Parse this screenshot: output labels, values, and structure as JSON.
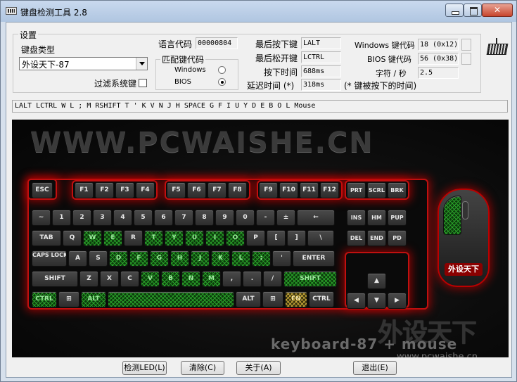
{
  "window": {
    "title": "键盘检测工具 2.8"
  },
  "settings": {
    "group_title": "设置",
    "keyboard_type_label": "键盘类型",
    "keyboard_type_value": "外设天下-87",
    "filter_label": "过滤系统键",
    "lang_code_label": "语言代码",
    "lang_code_value": "00000804",
    "match_code_label": "匹配键代码",
    "windows_label": "Windows",
    "bios_label": "BIOS",
    "selected_match": "BIOS",
    "last_press_label": "最后按下键",
    "last_press_value": "LALT",
    "last_release_label": "最后松开键",
    "last_release_value": "LCTRL",
    "press_time_label": "按下时间",
    "press_time_value": "688ms",
    "delay_label": "延迟时间 (*)",
    "delay_value": "318ms",
    "delay_note": "(* 键被按下的时间)",
    "win_code_label": "Windows 键代码",
    "win_code_value": "18 (0x12)",
    "bios_code_label": "BIOS 键代码",
    "bios_code_value": "56 (0x38)",
    "cps_label": "字符 / 秒",
    "cps_value": "2.5"
  },
  "log": "LALT LCTRL W L ; M RSHIFT T ' K V N J H SPACE G F I U Y D E B O L Mouse",
  "banner": {
    "site": "WWW.PCWAISHE.CN",
    "product": "keyboard-87 + mouse",
    "url": "www.pcwaishe.cn",
    "cn_logo": "外设天下",
    "mouse_logo": "外设天下"
  },
  "keyboard": {
    "rows": [
      [
        {
          "k": "ESC"
        }
      ],
      [
        {
          "k": "F1"
        },
        {
          "k": "F2"
        },
        {
          "k": "F3"
        },
        {
          "k": "F4"
        }
      ],
      [
        {
          "k": "F5"
        },
        {
          "k": "F6"
        },
        {
          "k": "F7"
        },
        {
          "k": "F8"
        }
      ],
      [
        {
          "k": "F9"
        },
        {
          "k": "F10"
        },
        {
          "k": "F11"
        },
        {
          "k": "F12"
        }
      ],
      [
        {
          "k": "PRT"
        },
        {
          "k": "SCRL"
        },
        {
          "k": "BRK"
        }
      ]
    ],
    "esc": "ESC",
    "fn_labels": [
      "F1",
      "F2",
      "F3",
      "F4",
      "F5",
      "F6",
      "F7",
      "F8",
      "F9",
      "F10",
      "F11",
      "F12"
    ],
    "sys_labels": [
      "PRT",
      "SCRL",
      "BRK"
    ],
    "num_row": [
      "~",
      "1",
      "2",
      "3",
      "4",
      "5",
      "6",
      "7",
      "8",
      "9",
      "0",
      "-",
      "±",
      "←"
    ],
    "q_row": [
      "TAB",
      "Q",
      "W",
      "E",
      "R",
      "T",
      "Y",
      "U",
      "I",
      "O",
      "P",
      "[",
      "]",
      "\\"
    ],
    "q_row_on": [
      false,
      false,
      true,
      true,
      false,
      true,
      true,
      true,
      true,
      true,
      false,
      false,
      false,
      false
    ],
    "a_row": [
      "CAPS LOCK",
      "A",
      "S",
      "D",
      "F",
      "G",
      "H",
      "J",
      "K",
      "L",
      ";",
      "'",
      "ENTER"
    ],
    "a_row_on": [
      false,
      false,
      false,
      true,
      true,
      true,
      true,
      true,
      true,
      true,
      true,
      false,
      false
    ],
    "z_row": [
      "SHIFT",
      "Z",
      "X",
      "C",
      "V",
      "B",
      "N",
      "M",
      ",",
      ".",
      "/",
      "SHIFT"
    ],
    "z_row_on": [
      false,
      false,
      false,
      false,
      true,
      true,
      true,
      true,
      false,
      false,
      false,
      true
    ],
    "bottom_row": [
      "CTRL",
      "⊞",
      "ALT",
      "",
      "ALT",
      "⊞",
      "FN",
      "CTRL"
    ],
    "space_label": "",
    "nav_top": [
      "INS",
      "HM",
      "PUP"
    ],
    "nav_bot": [
      "DEL",
      "END",
      "PD"
    ],
    "arrows": [
      "▲",
      "◀",
      "▼",
      "▶"
    ]
  },
  "buttons": {
    "led": "检测LED(L)",
    "clear": "清除(C)",
    "about": "关于(A)",
    "exit": "退出(E)"
  }
}
